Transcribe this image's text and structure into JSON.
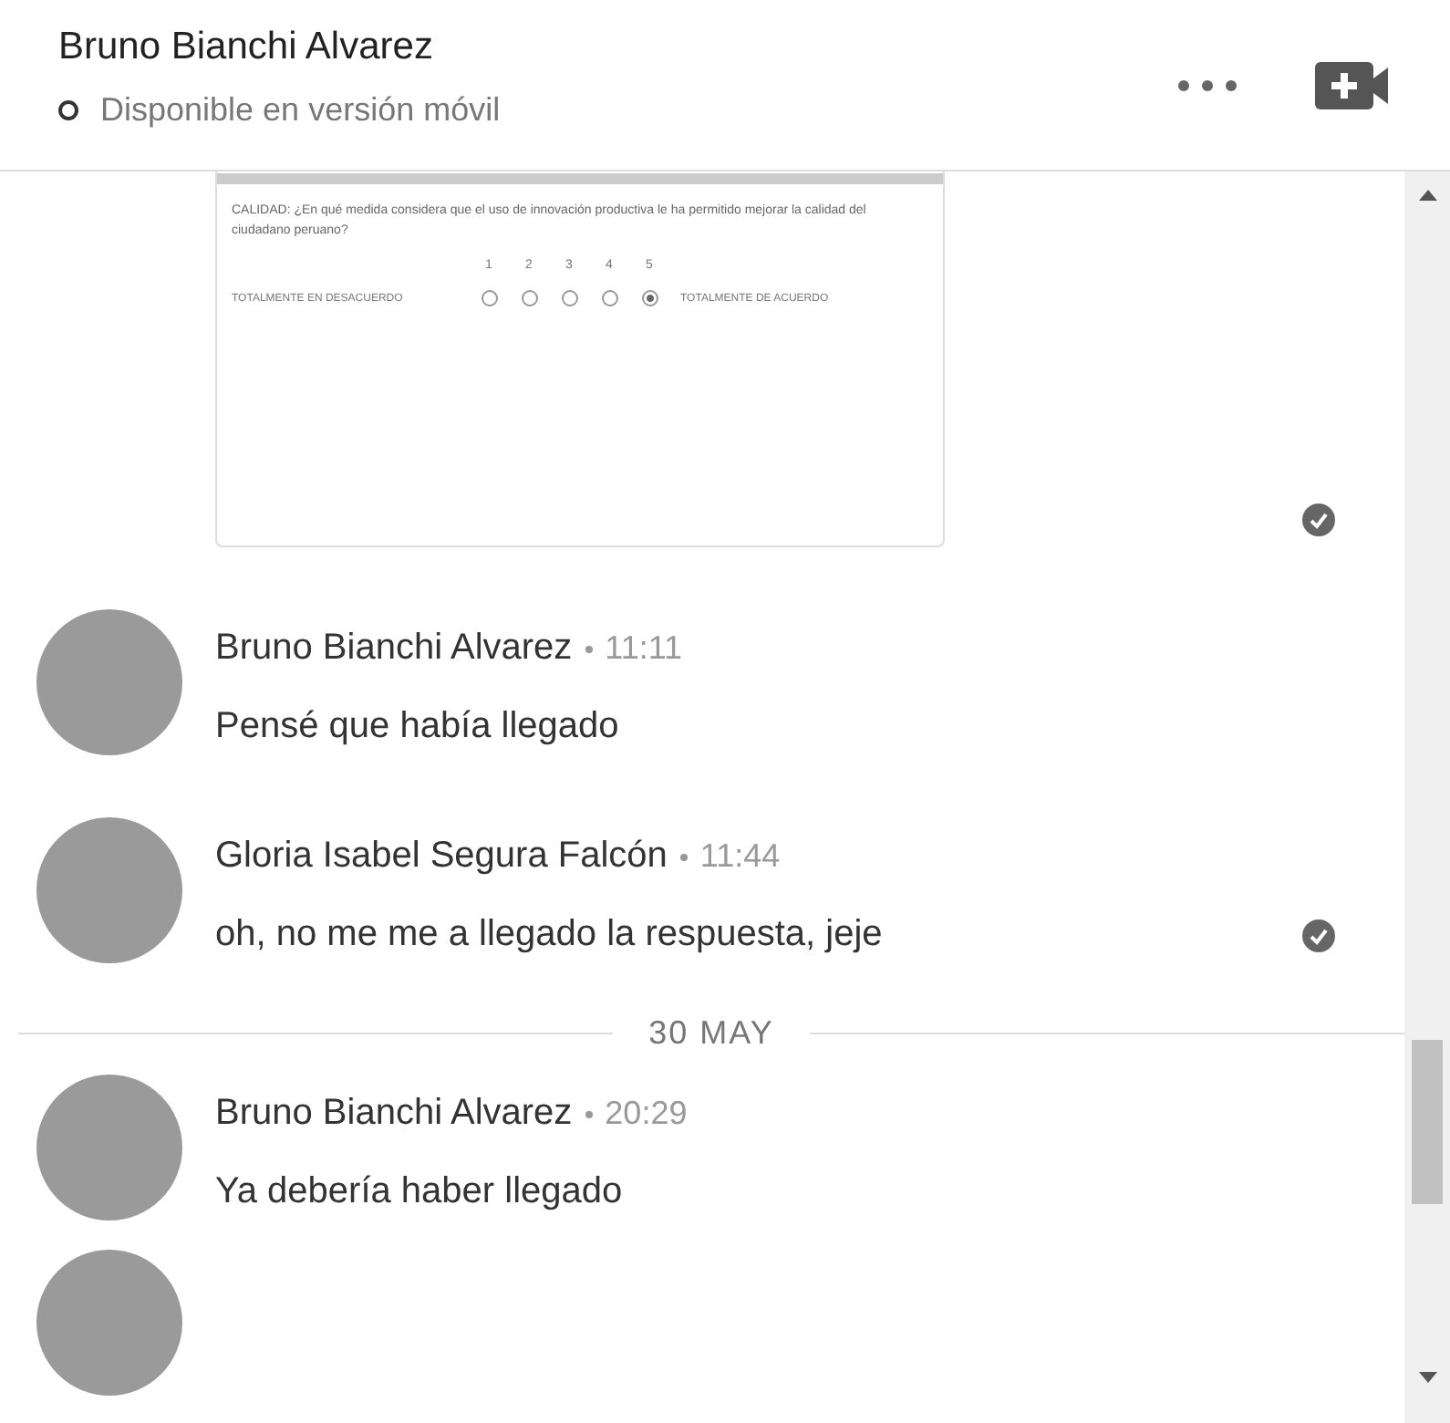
{
  "header": {
    "title": "Bruno Bianchi Alvarez",
    "status": "Disponible en versión móvil"
  },
  "messages": [
    {
      "kind": "form_image",
      "read": true,
      "form": {
        "question": "CALIDAD: ¿En qué medida considera que el uso de innovación productiva le ha permitido mejorar la calidad del ciudadano peruano?",
        "scale": [
          "1",
          "2",
          "3",
          "4",
          "5"
        ],
        "options": [
          {
            "selected": false
          },
          {
            "selected": false
          },
          {
            "selected": false
          },
          {
            "selected": false
          },
          {
            "selected": true
          }
        ],
        "left_label": "TOTALMENTE EN DESACUERDO",
        "right_label": "TOTALMENTE DE ACUERDO"
      }
    },
    {
      "kind": "text",
      "author": "Bruno Bianchi Alvarez",
      "time": "11:11",
      "text": "Pensé que había llegado",
      "read": false
    },
    {
      "kind": "text",
      "author": "Gloria Isabel Segura Falcón",
      "time": "11:44",
      "text": "oh, no me me a llegado la respuesta, jeje",
      "read": true
    },
    {
      "kind": "date",
      "label": "30 MAY"
    },
    {
      "kind": "text",
      "author": "Bruno Bianchi Alvarez",
      "time": "20:29",
      "text": "Ya debería haber llegado",
      "read": false
    },
    {
      "kind": "cut"
    }
  ]
}
